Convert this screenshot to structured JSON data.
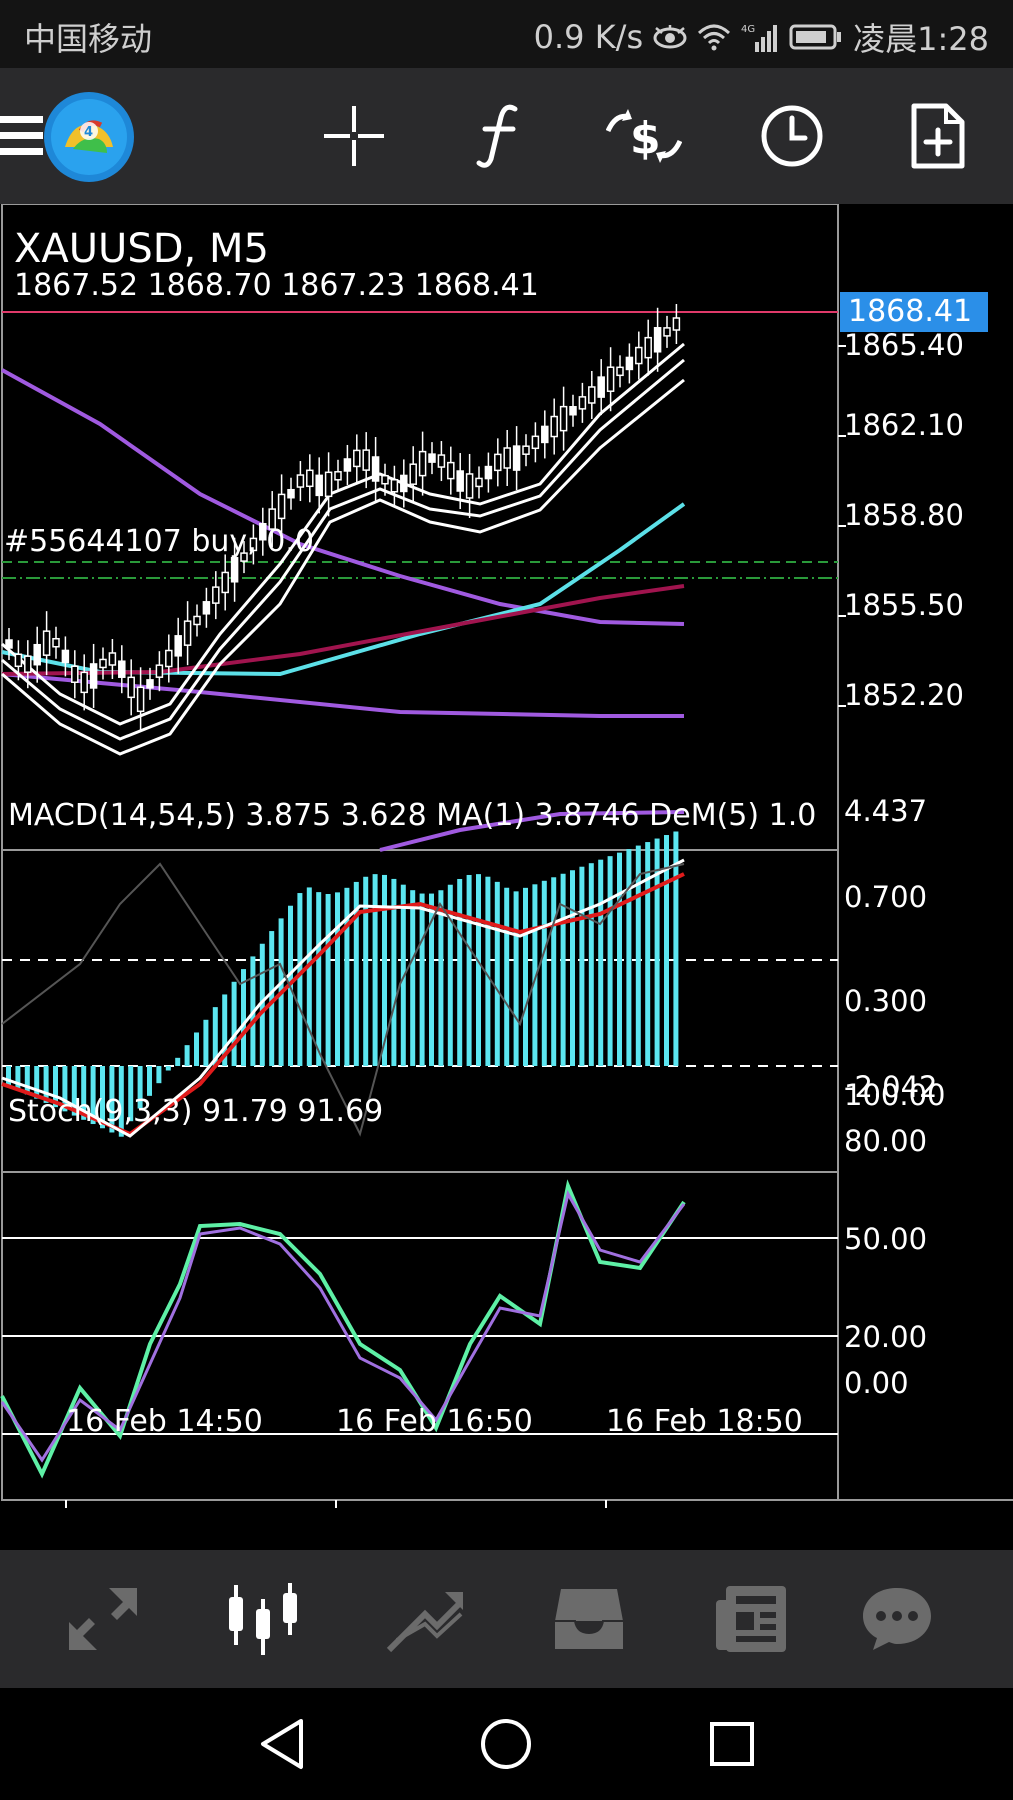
{
  "status_bar": {
    "carrier": "中国移动",
    "speed": "0.9 K/s",
    "network": "4G",
    "time": "凌晨1:28"
  },
  "toolbar": {
    "icons": [
      "menu-icon",
      "metatrader-logo",
      "crosshair-icon",
      "function-icon",
      "trade-icon",
      "timeframe-clock-icon",
      "add-object-icon"
    ]
  },
  "chart": {
    "symbol_title": "XAUUSD, M5",
    "ohlc": "1867.52 1868.70 1867.23 1868.41",
    "current_price": "1868.41",
    "order_label": "#55644107 buy, 0.0",
    "price_axis": [
      "1865.40",
      "1862.10",
      "1858.80",
      "1855.50",
      "1852.20"
    ],
    "time_axis": [
      "16 Feb 14:50",
      "16 Feb 16:50",
      "16 Feb 18:50"
    ],
    "macd": {
      "label": "MACD(14,54,5) 3.875 3.628 MA(1) 3.8746 DeM(5) 1.0",
      "axis": [
        "4.437",
        "0.700",
        "0.300",
        "-2.042"
      ]
    },
    "stoch": {
      "label": "Stoch(9,3,3) 91.79 91.69",
      "axis": [
        "100.00",
        "80.00",
        "50.00",
        "20.00",
        "0.00"
      ]
    }
  },
  "bottom_nav": {
    "items": [
      "quotes-icon",
      "chart-icon",
      "trade-icon",
      "history-icon",
      "news-icon",
      "chat-icon"
    ],
    "active": "chart-icon"
  },
  "colors": {
    "background": "#000000",
    "toolbar": "#2a2a2c",
    "price_tag": "#2b8fe8",
    "macd_hist": "#5ce6f0",
    "macd_signal": "#e01b1b",
    "stoch_main": "#5ef0a6",
    "stoch_signal": "#a070e0",
    "ma_purple": "#a05ae0",
    "ma_cyan": "#5ce0e8",
    "ma_maroon": "#a0144e"
  }
}
